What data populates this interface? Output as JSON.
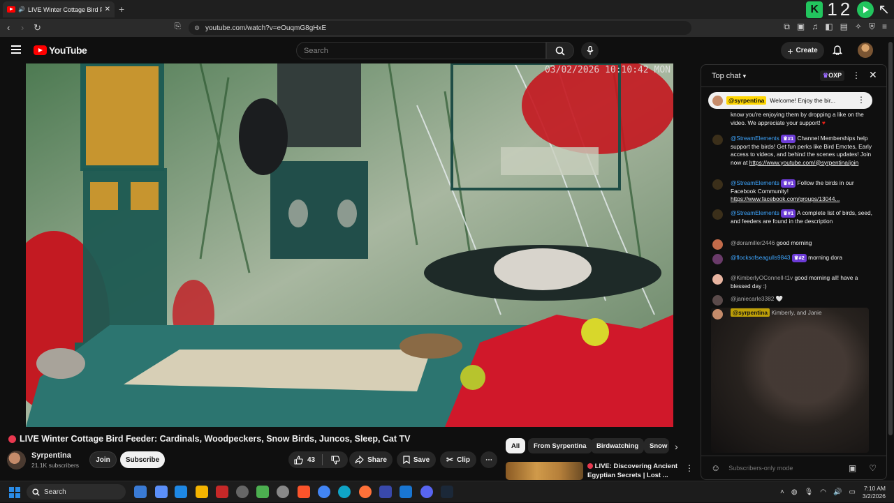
{
  "browser": {
    "tab_title": "LIVE Winter Cottage Bird F",
    "url": "youtube.com/watch?v=eOuqmG8gHxE",
    "ext_badge": "12"
  },
  "youtube": {
    "logo_text": "YouTube",
    "search_placeholder": "Search",
    "create_label": "Create"
  },
  "video": {
    "timestamp_overlay": "03/02/2026 10:10:42 MON",
    "title": "LIVE Winter Cottage Bird Feeder: Cardinals, Woodpeckers, Snow Birds, Juncos, Sleep, Cat TV",
    "channel": "Syrpentina",
    "subscribers": "21.1K subscribers",
    "join_label": "Join",
    "subscribe_label": "Subscribe",
    "likes": "43",
    "share_label": "Share",
    "save_label": "Save",
    "clip_label": "Clip"
  },
  "chips": [
    "All",
    "From Syrpentina",
    "Birdwatching",
    "Snow"
  ],
  "related": {
    "title": "LIVE: Discovering Ancient Egyptian Secrets | Lost ..."
  },
  "chat": {
    "header_label": "Top chat",
    "oxp_label": "OXP",
    "pinned_user": "@syrpentina",
    "pinned_text": "Welcome! Enjoy the bir...",
    "pinned_continued": "know you're enjoying them by dropping a like on the video. We appreciate your support!",
    "messages": [
      {
        "user": "@StreamElements",
        "badge": "#1",
        "text": "Channel Memberships help support the birds! Get fun perks like Bird Emotes, Early access to videos, and behind the scenes updates! Join now at",
        "link": "https://www.youtube.com/@syrpentina/join"
      },
      {
        "user": "@StreamElements",
        "badge": "#1",
        "text": "Follow the birds in our Facebook Community!",
        "link": "https://www.facebook.com/groups/13044..."
      },
      {
        "user": "@StreamElements",
        "badge": "#1",
        "text": "A complete list of birds, seed, and feeders are found in the description",
        "link": ""
      },
      {
        "user": "@doramiller2446",
        "badge": "",
        "text": "good morning",
        "link": ""
      },
      {
        "user": "@flocksofseagulls9843",
        "badge": "#2",
        "text": "morning dora",
        "link": ""
      },
      {
        "user": "@KimberlyOConnell-t1v",
        "badge": "",
        "text": "good morning all! have a blessed day :)",
        "link": ""
      },
      {
        "user": "@janiecarle3382",
        "badge": "",
        "text": "🤍",
        "link": ""
      },
      {
        "user": "@syrpentina",
        "badge": "",
        "text": "Kimberly, and Janie",
        "link": ""
      }
    ],
    "footer_text": "Subscribers-only mode"
  },
  "taskbar": {
    "search_label": "Search",
    "time": "7:10 AM",
    "date": "3/2/2026"
  }
}
